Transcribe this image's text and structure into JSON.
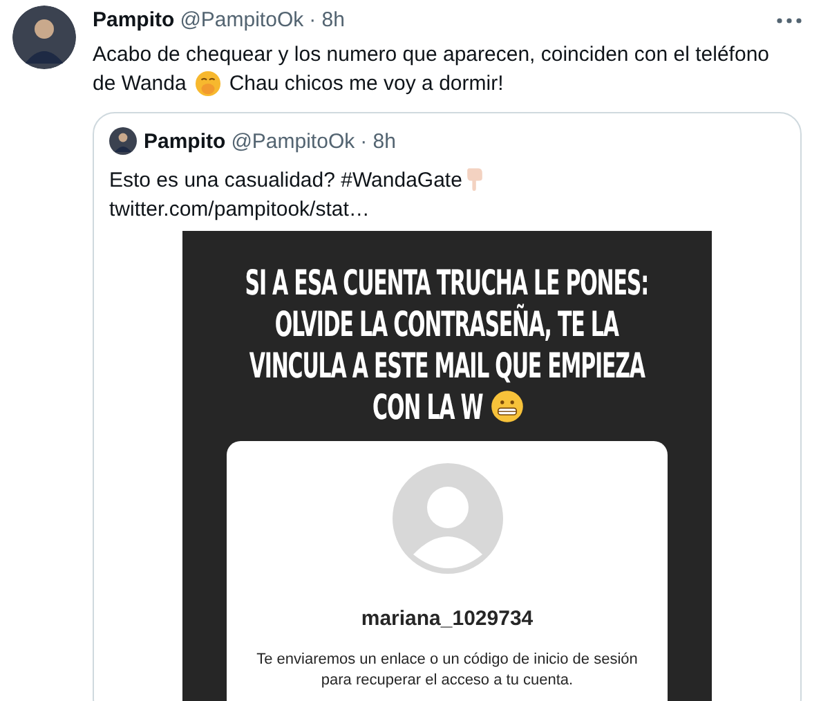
{
  "tweet": {
    "author": "Pampito",
    "handle": "@PampitoOk",
    "time": "· 8h",
    "text_line_1": "Acabo de chequear y los numero que aparecen, coinciden con el teléfono",
    "text_before_emoji": "de Wanda",
    "text_after_emoji": "Chau chicos me voy a dormir!"
  },
  "quoted_tweet": {
    "author": "Pampito",
    "handle": "@PampitoOk",
    "time": "· 8h",
    "text": "Esto es una casualidad? #WandaGate",
    "link": "twitter.com/pampitook/stat…",
    "image": {
      "headline_lines": [
        "SI A ESA CUENTA TRUCHA LE PONES:",
        "OLVIDE LA CONTRASEÑA, TE LA",
        "VINCULA A ESTE MAIL QUE EMPIEZA",
        "CON LA W"
      ],
      "username": "mariana_1029734",
      "message": "Te enviaremos un enlace o un código de inicio de sesión para recuperar el acceso a tu cuenta."
    }
  }
}
